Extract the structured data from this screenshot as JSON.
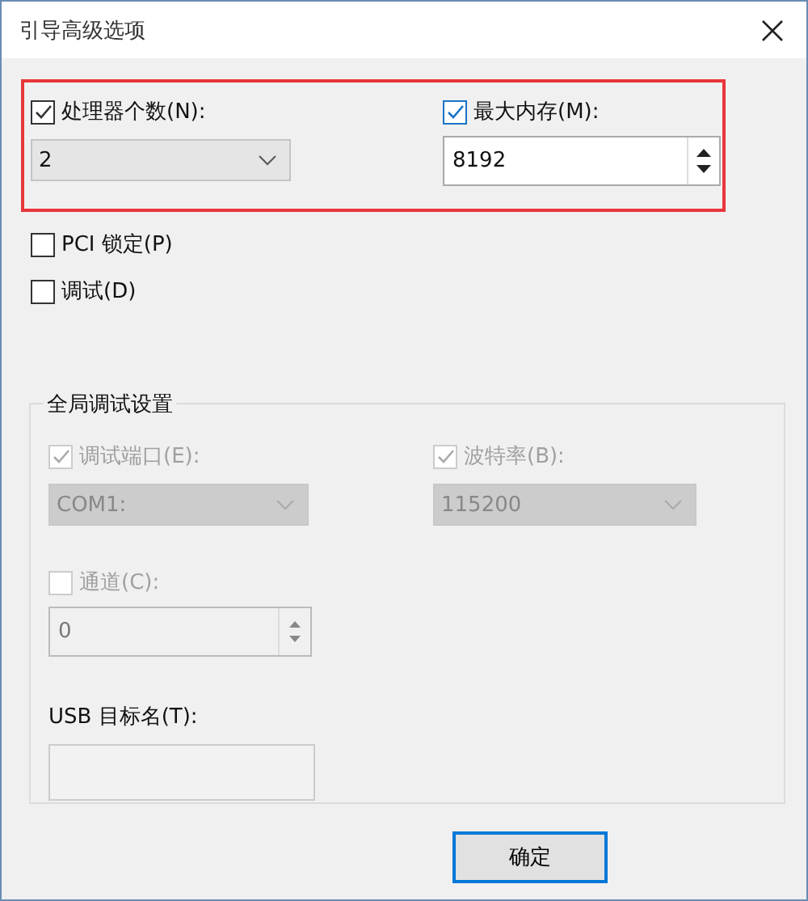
{
  "window": {
    "title": "引导高级选项"
  },
  "top_section": {
    "highlighted": true,
    "processors": {
      "label": "处理器个数(N):",
      "checked": true,
      "value": "2"
    },
    "memory": {
      "label": "最大内存(M):",
      "checked": true,
      "value": "8192"
    }
  },
  "options": [
    {
      "label": "PCI 锁定(P)",
      "checked": false
    },
    {
      "label": "调试(D)",
      "checked": false
    }
  ],
  "debug_settings": {
    "title": "全局调试设置",
    "debug_port": {
      "label": "调试端口(E):",
      "checked": true,
      "disabled": true,
      "value": "COM1:"
    },
    "baud_rate": {
      "label": "波特率(B):",
      "checked": true,
      "disabled": true,
      "value": "115200"
    },
    "channel": {
      "label": "通道(C):",
      "checked": false,
      "disabled": true,
      "value": "0"
    },
    "usb_target": {
      "label": "USB 目标名(T):",
      "disabled": true
    }
  },
  "buttons": [
    {
      "label": "确定",
      "default": true
    }
  ]
}
